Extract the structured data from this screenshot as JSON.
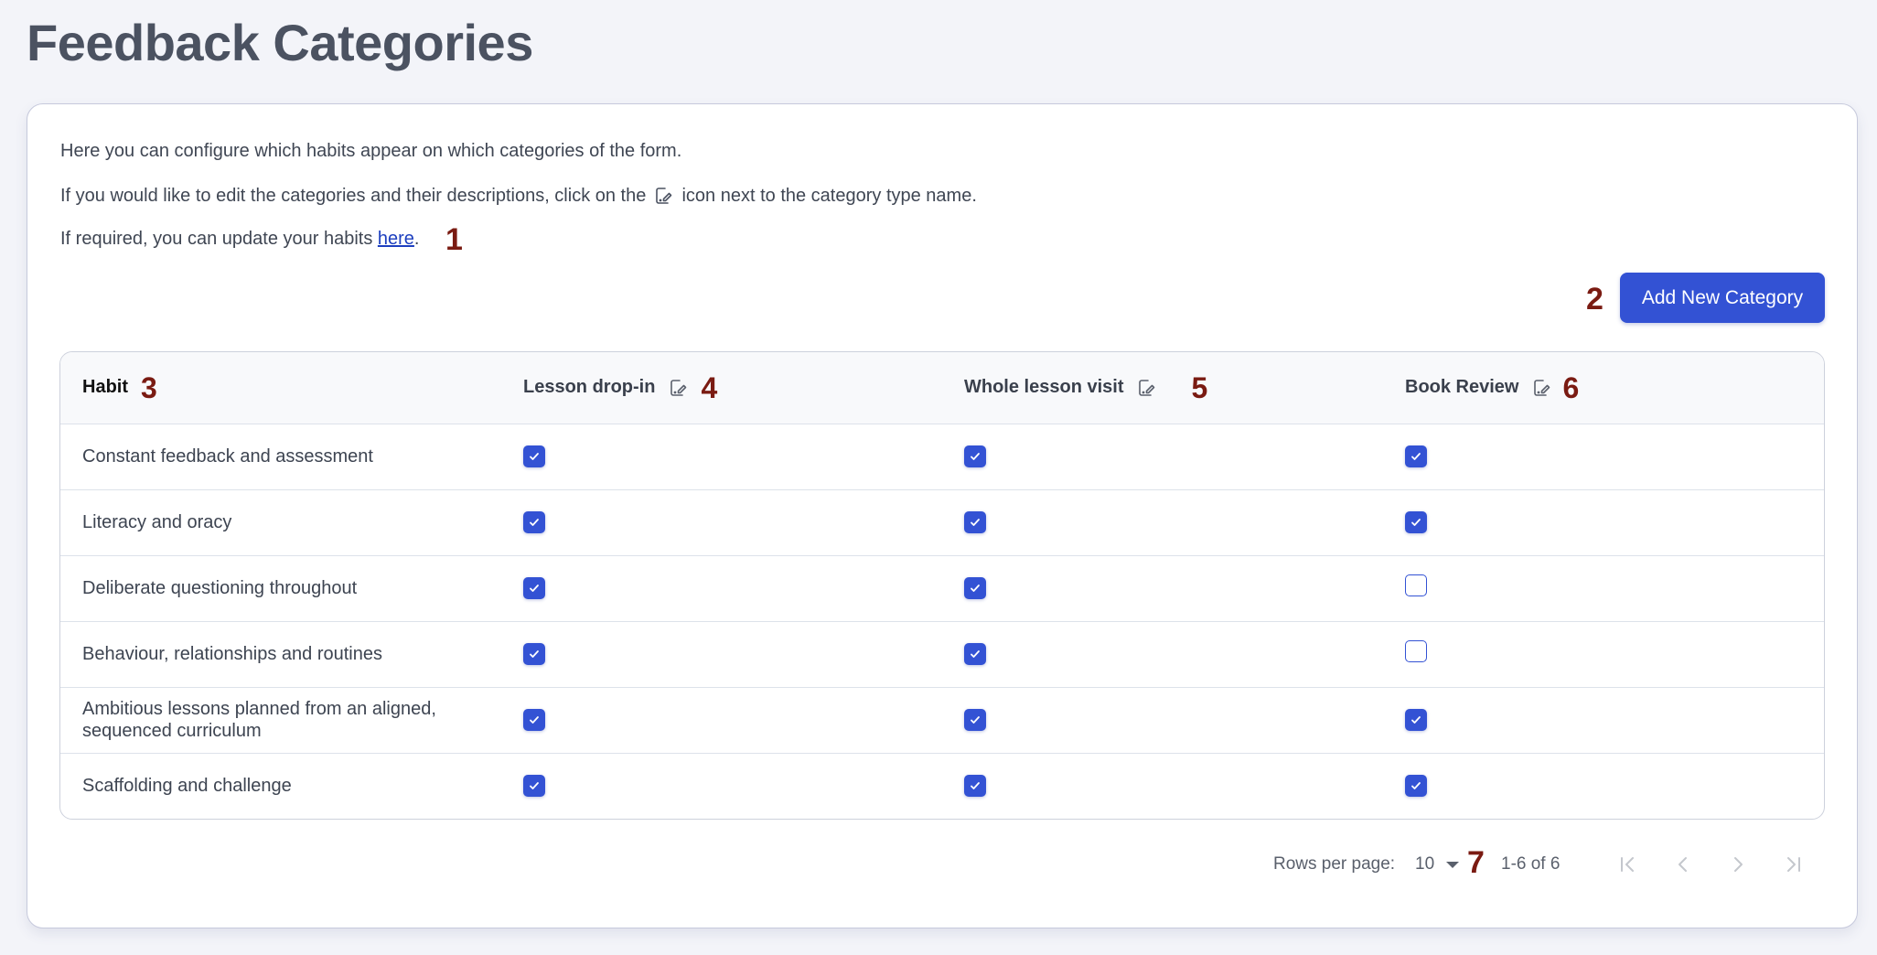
{
  "page": {
    "title": "Feedback Categories"
  },
  "intro": {
    "line1": "Here you can configure which habits appear on which categories of the form.",
    "line2_before": "If you would like to edit the categories and their descriptions, click on the",
    "line2_icon": "edit-icon",
    "line2_after": "icon next to the category type name.",
    "line3_before": "If required, you can update your habits",
    "line3_link": "here",
    "line3_after": "."
  },
  "markers": [
    "1",
    "2",
    "3",
    "4",
    "5",
    "6",
    "7"
  ],
  "toolbar": {
    "add_button_label": "Add New Category"
  },
  "colors": {
    "accent": "#3352d4",
    "marker": "#7a1b12",
    "link": "#1d3fbf",
    "background": "#f3f4f9"
  },
  "table": {
    "columns": [
      {
        "label": "Habit",
        "editable": false
      },
      {
        "label": "Lesson drop-in",
        "editable": true,
        "icon": "edit-icon"
      },
      {
        "label": "Whole lesson visit",
        "editable": true,
        "icon": "edit-icon"
      },
      {
        "label": "Book Review",
        "editable": true,
        "icon": "edit-icon"
      }
    ],
    "rows": [
      {
        "habit": "Constant feedback and assessment",
        "values": [
          true,
          true,
          true
        ]
      },
      {
        "habit": "Literacy and oracy",
        "values": [
          true,
          true,
          true
        ]
      },
      {
        "habit": "Deliberate questioning throughout",
        "values": [
          true,
          true,
          false
        ]
      },
      {
        "habit": "Behaviour, relationships and routines",
        "values": [
          true,
          true,
          false
        ]
      },
      {
        "habit": "Ambitious lessons planned from an aligned, sequenced curriculum",
        "values": [
          true,
          true,
          true
        ]
      },
      {
        "habit": "Scaffolding and challenge",
        "values": [
          true,
          true,
          true
        ]
      }
    ]
  },
  "pagination": {
    "rows_per_page_label": "Rows per page:",
    "rows_per_page_value": "10",
    "range_text": "1-6 of 6",
    "buttons": [
      "first-page",
      "previous-page",
      "next-page",
      "last-page"
    ],
    "buttons_enabled": false
  }
}
